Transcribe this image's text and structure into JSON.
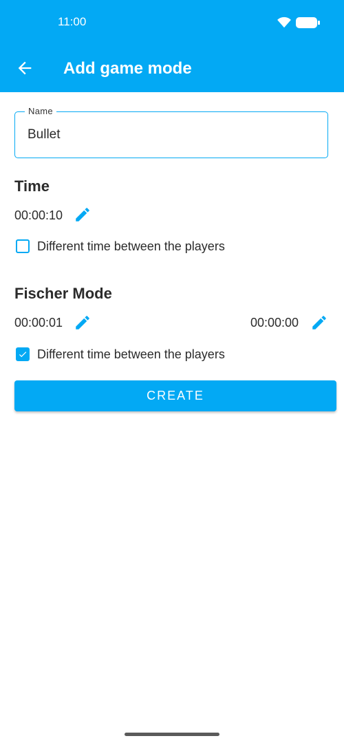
{
  "colors": {
    "primary": "#03a9f4",
    "text": "#2b2b2b",
    "on_primary": "#ffffff"
  },
  "status_bar": {
    "time": "11:00",
    "wifi_icon": "wifi-icon",
    "battery_icon": "battery-icon"
  },
  "app_bar": {
    "back_icon": "arrow-left-icon",
    "title": "Add game mode"
  },
  "form": {
    "name_label": "Name",
    "name_value": "Bullet"
  },
  "time_section": {
    "title": "Time",
    "value": "00:00:10",
    "edit_icon": "pencil-icon",
    "different_time_label": "Different time between the players",
    "different_time_checked": false
  },
  "fischer_section": {
    "title": "Fischer Mode",
    "player1_value": "00:00:01",
    "player2_value": "00:00:00",
    "edit_icon": "pencil-icon",
    "different_time_label": "Different time between the players",
    "different_time_checked": true
  },
  "actions": {
    "create_label": "CREATE"
  }
}
